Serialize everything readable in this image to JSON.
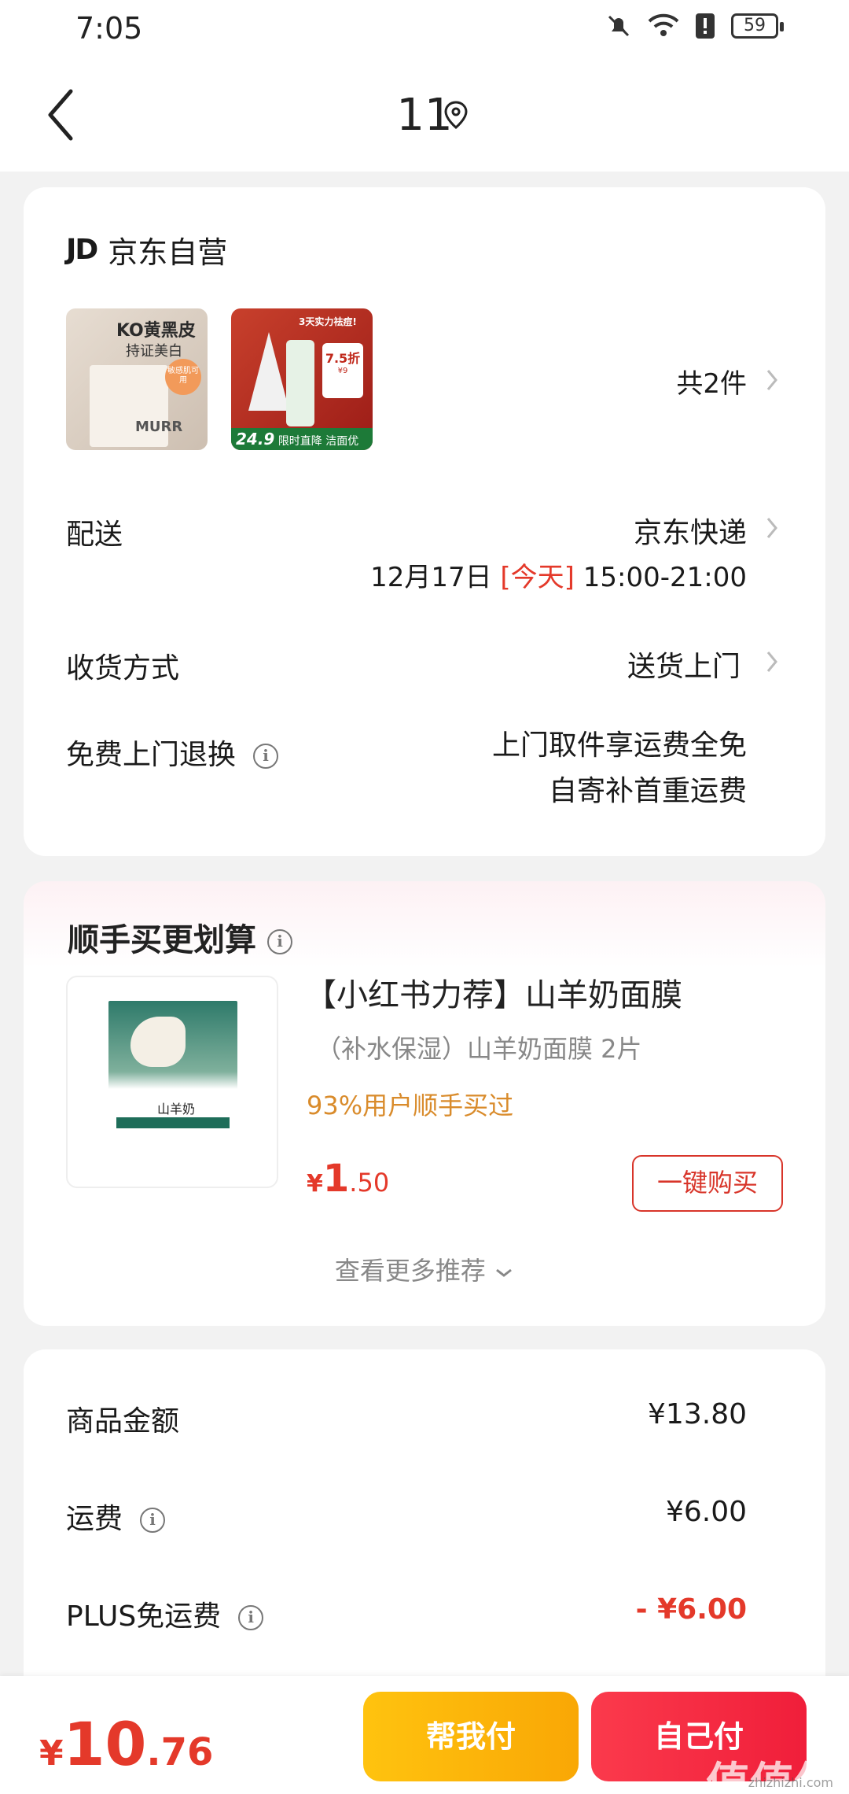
{
  "status_bar": {
    "time": "7:05",
    "battery": "59"
  },
  "header": {
    "title": "11"
  },
  "order_card": {
    "shop_logo": "JD",
    "shop_name": "京东自营",
    "thumb1": {
      "headline": "KO黄黑皮",
      "sub": "持证美白",
      "badge": "敏感肌可用",
      "brand": "MURR"
    },
    "thumb2": {
      "headline": "3天实力祛痘!",
      "discount": "7.5折",
      "price_tag": "¥9",
      "promo": "24.9",
      "footer": "限时直降 洁面优选!"
    },
    "item_count": "共2件",
    "delivery": {
      "label": "配送",
      "carrier": "京东快递",
      "date": "12月17日",
      "today": "[今天]",
      "window": "15:00-21:00"
    },
    "receive": {
      "label": "收货方式",
      "value": "送货上门"
    },
    "return": {
      "label": "免费上门退换",
      "line1": "上门取件享运费全免",
      "line2": "自寄补首重运费"
    }
  },
  "recommend_card": {
    "title": "顺手买更划算",
    "product": {
      "image_label": "山羊奶",
      "title": "【小红书力荐】山羊奶面膜",
      "subtitle": "（补水保湿）山羊奶面膜 2片",
      "buyers": "93%用户顺手买过",
      "price_symbol": "¥",
      "price_int": "1",
      "price_dec": ".50",
      "buy_label": "一键购买"
    },
    "more_label": "查看更多推荐"
  },
  "summary_card": {
    "rows": [
      {
        "label": "商品金额",
        "value": "¥13.80"
      },
      {
        "label": "运费",
        "value": "¥6.00"
      },
      {
        "label": "PLUS免运费",
        "value": "- ¥6.00"
      }
    ]
  },
  "bottom_bar": {
    "total_symbol": "¥",
    "total_int": "10",
    "total_dec": ".76",
    "help_pay": "帮我付",
    "self_pay": "自己付"
  },
  "watermark": {
    "text": "值值值",
    "url": "zhizhizhi.com"
  },
  "colors": {
    "accent_red": "#e4392a",
    "button_yellow": "#ffc30f",
    "button_red": "#f01e3a",
    "buyers_orange": "#d98b2b"
  }
}
